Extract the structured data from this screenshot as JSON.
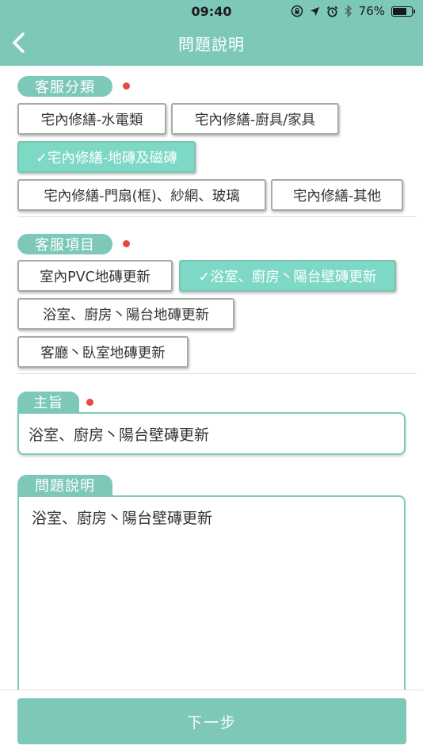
{
  "status_bar": {
    "time": "09:40",
    "battery_percent": "76%",
    "battery_level": 0.76,
    "icons": [
      "rotation-lock-icon",
      "location-arrow-icon",
      "alarm-icon",
      "bluetooth-icon",
      "battery-icon"
    ]
  },
  "nav": {
    "title": "問題說明",
    "back_icon": "chevron-left-icon"
  },
  "category": {
    "label": "客服分類",
    "required": true,
    "options": [
      {
        "label": "宅內修繕-水電類",
        "selected": false
      },
      {
        "label": "宅內修繕-廚具/家具",
        "selected": false
      },
      {
        "label": "✓宅內修繕-地磚及磁磚",
        "selected": true
      },
      {
        "label": "宅內修繕-門扇(框)、紗網、玻璃",
        "selected": false
      },
      {
        "label": "宅內修繕-其他",
        "selected": false
      }
    ]
  },
  "item": {
    "label": "客服項目",
    "required": true,
    "options": [
      {
        "label": "室內PVC地磚更新",
        "selected": false
      },
      {
        "label": "✓浴室、廚房丶陽台壁磚更新",
        "selected": true
      },
      {
        "label": "浴室、廚房丶陽台地磚更新",
        "selected": false
      },
      {
        "label": "客廳丶臥室地磚更新",
        "selected": false
      }
    ]
  },
  "subject": {
    "label": "主旨",
    "required": true,
    "value": "浴室、廚房丶陽台壁磚更新"
  },
  "description": {
    "label": "問題說明",
    "value": "浴室、廚房丶陽台壁磚更新"
  },
  "footer": {
    "next_label": "下一步"
  },
  "colors": {
    "accent": "#7dc8b8",
    "selected_chip": "#7dd8c6",
    "required_dot": "#e84545"
  }
}
